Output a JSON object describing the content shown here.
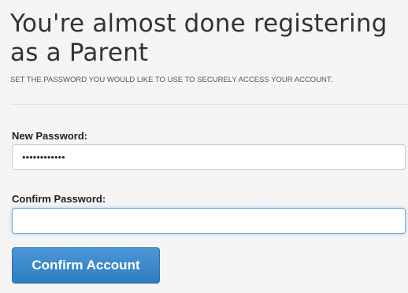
{
  "header": {
    "title": "You're almost done registering as a Parent",
    "subtitle": "SET THE PASSWORD YOU WOULD LIKE TO USE TO SECURELY ACCESS YOUR ACCOUNT."
  },
  "form": {
    "new_password": {
      "label": "New Password:",
      "value": "••••••••••••"
    },
    "confirm_password": {
      "label": "Confirm Password:",
      "value": ""
    },
    "submit_label": "Confirm Account"
  },
  "colors": {
    "button_top": "#4a97d6",
    "button_bottom": "#2f7cc0",
    "focus_border": "#66afe9",
    "text": "#333333"
  }
}
